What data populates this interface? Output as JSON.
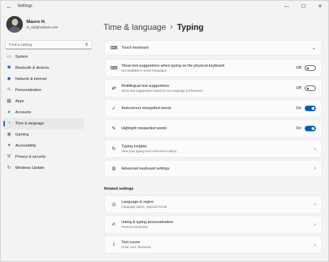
{
  "window": {
    "title": "Settings",
    "minimize": "—",
    "maximize": "☐",
    "close": "✕",
    "back": "←"
  },
  "profile": {
    "name": "Mauro H.",
    "email": "m_lab@outlook.com"
  },
  "search": {
    "placeholder": "Find a setting",
    "icon": "search-icon"
  },
  "sidebar": {
    "items": [
      {
        "label": "System",
        "icon": "monitor-icon",
        "glyph": "▭",
        "color": "#2b88d8",
        "active": false
      },
      {
        "label": "Bluetooth & devices",
        "icon": "bluetooth-icon",
        "glyph": "✱",
        "color": "#0067c0",
        "active": false
      },
      {
        "label": "Network & internet",
        "icon": "wifi-icon",
        "glyph": "◆",
        "color": "#2a5ea8",
        "active": false
      },
      {
        "label": "Personalization",
        "icon": "brush-icon",
        "glyph": "✎",
        "color": "#d46a1c",
        "active": false
      },
      {
        "label": "Apps",
        "icon": "apps-icon",
        "glyph": "▦",
        "color": "#5c6b7a",
        "active": false
      },
      {
        "label": "Accounts",
        "icon": "person-icon",
        "glyph": "●",
        "color": "#2f9b58",
        "active": false
      },
      {
        "label": "Time & language",
        "icon": "globe-clock-icon",
        "glyph": "◔",
        "color": "#1a73c5",
        "active": true
      },
      {
        "label": "Gaming",
        "icon": "gamepad-icon",
        "glyph": "◉",
        "color": "#6b6b6b",
        "active": false
      },
      {
        "label": "Accessibility",
        "icon": "accessibility-icon",
        "glyph": "✦",
        "color": "#1a73c5",
        "active": false
      },
      {
        "label": "Privacy & security",
        "icon": "shield-icon",
        "glyph": "⛨",
        "color": "#6b6b6b",
        "active": false
      },
      {
        "label": "Windows Update",
        "icon": "update-icon",
        "glyph": "↻",
        "color": "#1a73c5",
        "active": false
      }
    ]
  },
  "breadcrumb": {
    "parent": "Time & language",
    "separator": "›",
    "current": "Typing"
  },
  "main": {
    "touch_keyboard": {
      "title": "Touch keyboard",
      "icon": "keyboard-icon",
      "chevron": "⌄"
    },
    "show_suggestions": {
      "title": "Show text suggestions when typing on the physical keyboard",
      "sub": "Not available in some languages",
      "icon": "keyboard-icon",
      "state": "Off",
      "on": false
    },
    "multilingual": {
      "title": "Multilingual text suggestions",
      "sub": "Show text suggestions based on my language preferences",
      "icon": "multilingual-icon",
      "state": "Off",
      "on": false
    },
    "autocorrect": {
      "title": "Autocorrect misspelled words",
      "icon": "autocorrect-icon",
      "state": "On",
      "on": true
    },
    "highlight": {
      "title": "Highlight misspelled words",
      "icon": "highlight-icon",
      "state": "On",
      "on": true
    },
    "typing_insights": {
      "title": "Typing insights",
      "sub": "View your typing and corrections history",
      "icon": "insights-icon",
      "chevron": "›"
    },
    "advanced_keyboard": {
      "title": "Advanced keyboard settings",
      "icon": "gear-icon",
      "chevron": "›"
    }
  },
  "related": {
    "label": "Related settings",
    "language_region": {
      "title": "Language & region",
      "sub": "Language packs, regional format",
      "icon": "language-icon",
      "chevron": "›"
    },
    "inking": {
      "title": "Inking & typing personalization",
      "sub": "Personal dictionary",
      "icon": "pen-icon",
      "chevron": "›"
    },
    "text_cursor": {
      "title": "Text cursor",
      "sub": "Color, size, thickness",
      "icon": "cursor-icon",
      "chevron": "›"
    }
  }
}
